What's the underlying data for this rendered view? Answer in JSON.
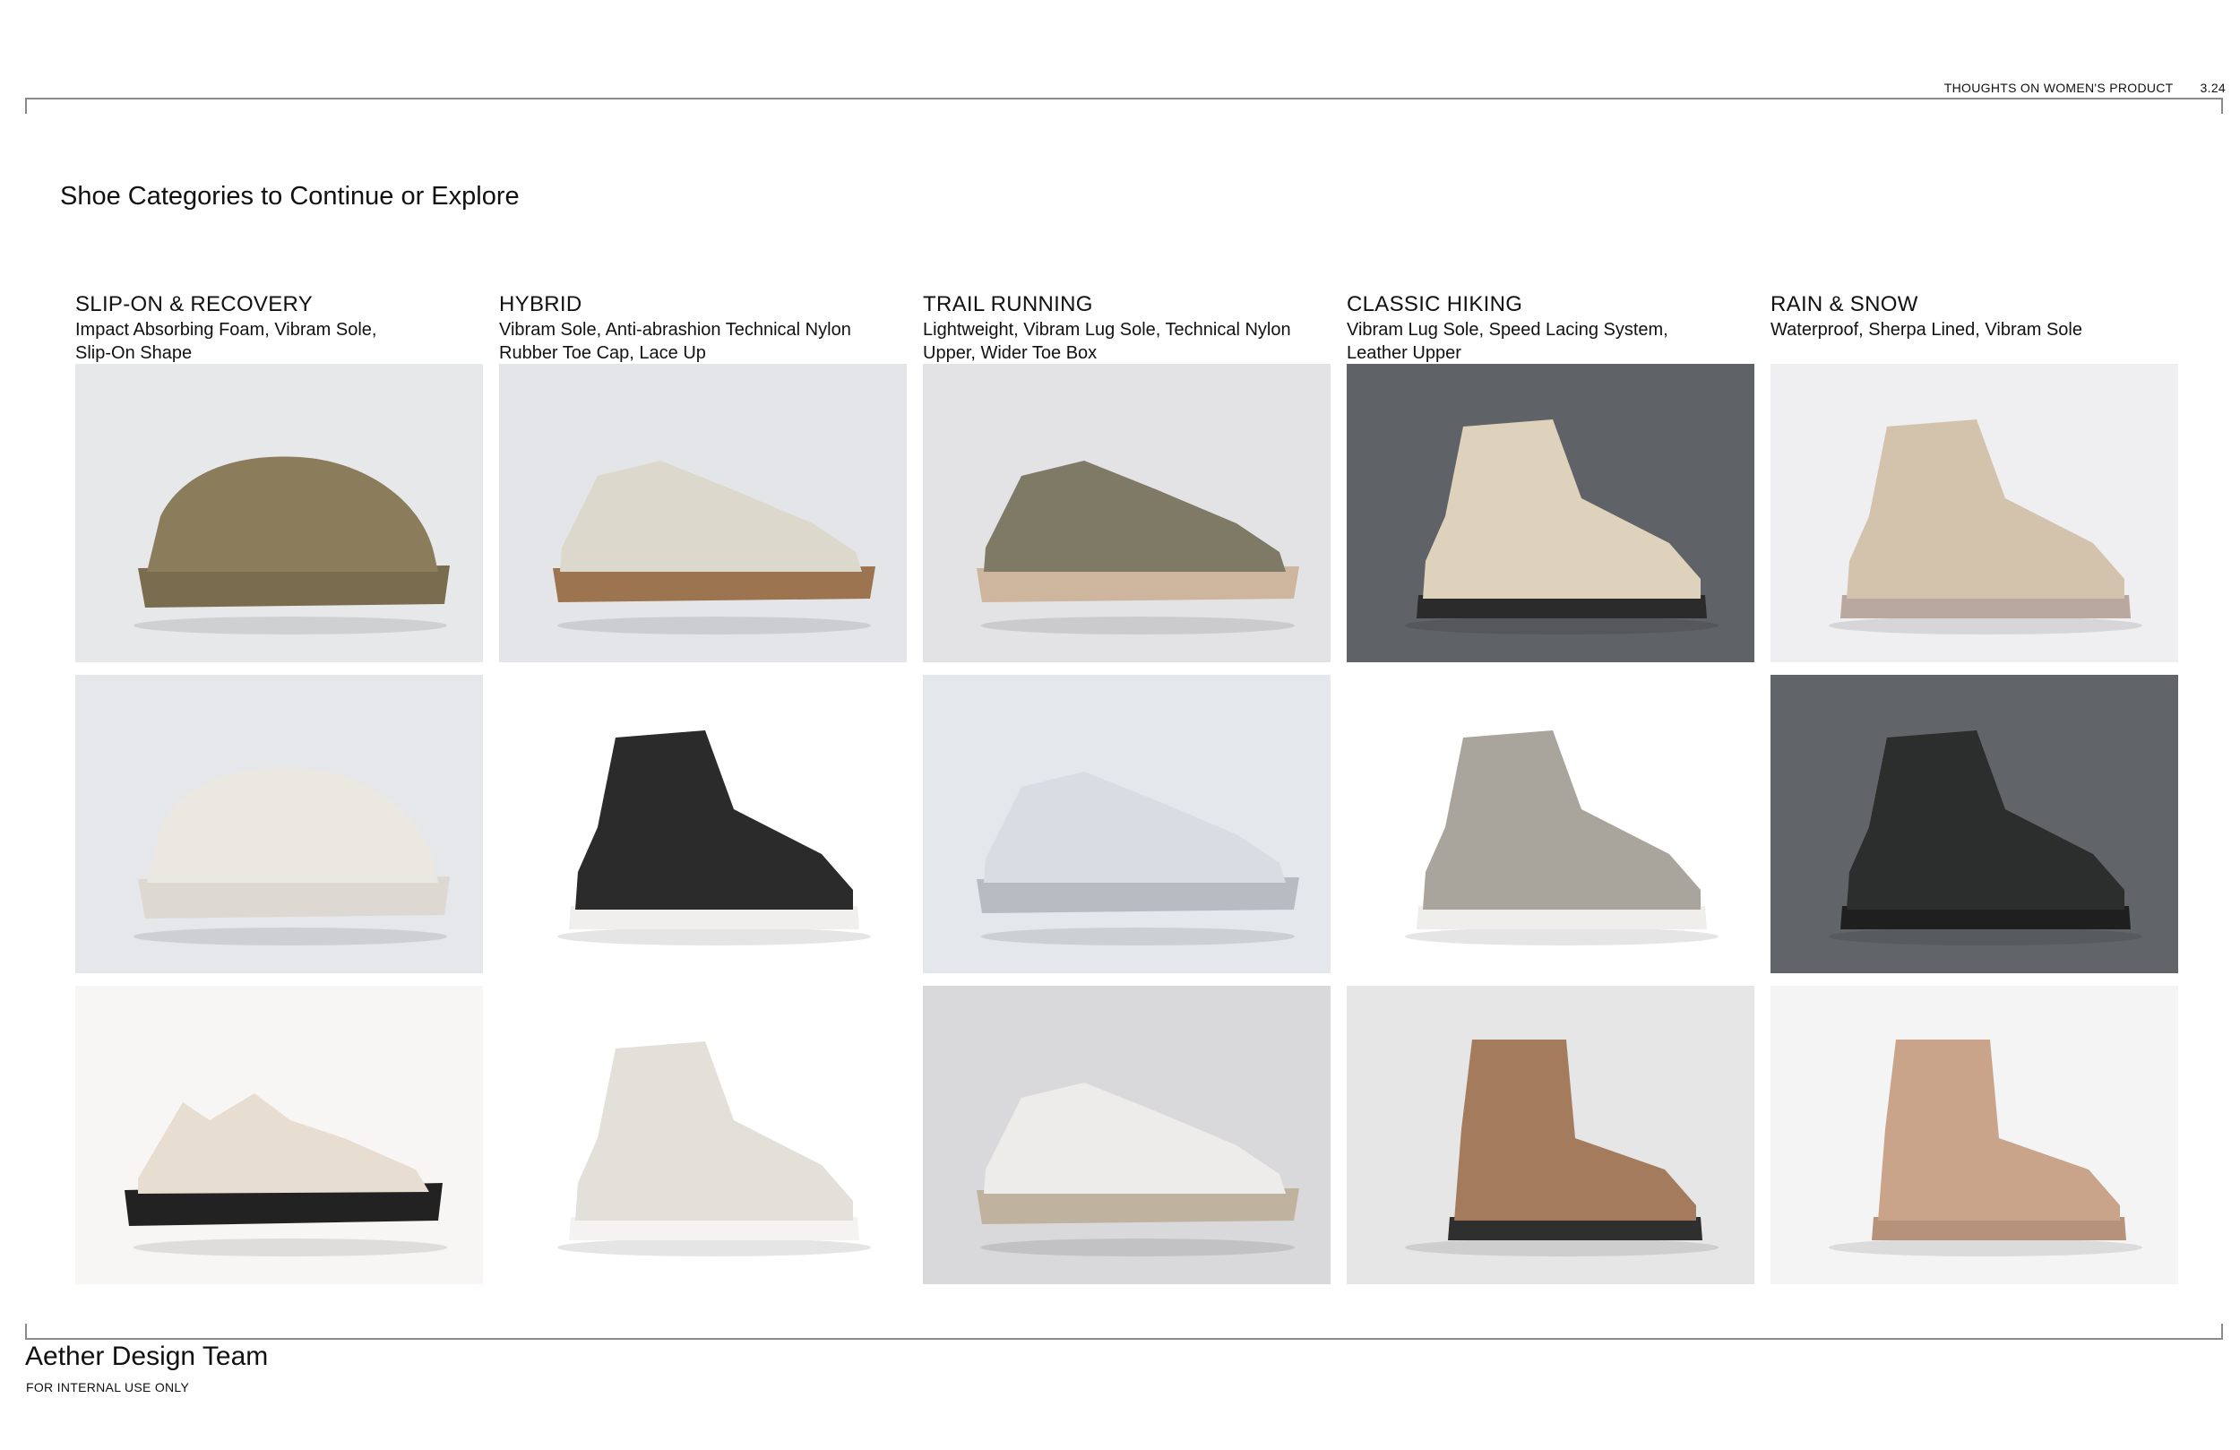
{
  "header": {
    "doc_title": "THOUGHTS ON WOMEN'S PRODUCT",
    "page_number": "3.24"
  },
  "page_title": "Shoe Categories to Continue or Explore",
  "categories": [
    {
      "name": "SLIP-ON & RECOVERY",
      "desc_line1": "Impact Absorbing Foam, Vibram Sole,",
      "desc_line2": "Slip-On Shape",
      "images": [
        {
          "name": "olive-strap-clog-image",
          "bg": "#e7e8ea",
          "upper": "#8b7c5b",
          "sole": "#7a6c4f",
          "style": "clog"
        },
        {
          "name": "white-mule-clog-image",
          "bg": "#e6e7ea",
          "upper": "#ebe8e2",
          "sole": "#ddd9d2",
          "style": "clog"
        },
        {
          "name": "chloe-strap-sandal-image",
          "bg": "#f8f6f4",
          "upper": "#e7ddd0",
          "sole": "#222222",
          "style": "sandal"
        }
      ]
    },
    {
      "name": "HYBRID",
      "desc_line1": "Vibram Sole, Anti-abrashion Technical Nylon",
      "desc_line2": "Rubber Toe Cap, Lace Up",
      "images": [
        {
          "name": "cream-hybrid-shoe-image",
          "bg": "#e4e5e8",
          "upper": "#ddd8cc",
          "sole": "#9c7550",
          "style": "low"
        },
        {
          "name": "black-hiking-boot-image",
          "bg": "#ffffff",
          "upper": "#2b2b2b",
          "sole": "#f0efed",
          "style": "boot"
        },
        {
          "name": "white-hiking-sneaker-image",
          "bg": "#ffffff",
          "upper": "#e3e0da",
          "sole": "#f4f3f1",
          "style": "boot"
        }
      ]
    },
    {
      "name": "TRAIL RUNNING",
      "desc_line1": "Lightweight, Vibram Lug Sole, Technical Nylon",
      "desc_line2": "Upper, Wider Toe Box",
      "images": [
        {
          "name": "olive-trail-runner-image",
          "bg": "#e3e3e6",
          "upper": "#7e7a66",
          "sole": "#cdb59e",
          "style": "low"
        },
        {
          "name": "silver-trail-runner-image",
          "bg": "#e4e7ec",
          "upper": "#d9dde3",
          "sole": "#b8bcc2",
          "style": "low"
        },
        {
          "name": "cream-trail-runner-image",
          "bg": "#d9d9dc",
          "upper": "#eeecea",
          "sole": "#bfb29e",
          "style": "low"
        }
      ]
    },
    {
      "name": "CLASSIC HIKING",
      "desc_line1": "Vibram Lug Sole, Speed Lacing System,",
      "desc_line2": "Leather Upper",
      "images": [
        {
          "name": "beige-hiking-boots-image",
          "bg": "#5f6266",
          "upper": "#dfd2bd",
          "sole": "#2b2b2b",
          "style": "boot"
        },
        {
          "name": "grey-suede-hiking-boot-image",
          "bg": "#ffffff",
          "upper": "#a9a49c",
          "sole": "#f0eeea",
          "style": "boot"
        },
        {
          "name": "tan-chelsea-boot-image",
          "bg": "#e6e6e6",
          "upper": "#a47c5d",
          "sole": "#2f2f2f",
          "style": "chelsea"
        }
      ]
    },
    {
      "name": "RAIN & SNOW",
      "desc_line1": "Waterproof, Sherpa Lined, Vibram Sole",
      "desc_line2": "",
      "images": [
        {
          "name": "beige-snow-boot-image",
          "bg": "#efeff1",
          "upper": "#d3c3ad",
          "sole": "#b9a8a0",
          "style": "boot"
        },
        {
          "name": "black-rain-boots-image",
          "bg": "#616569",
          "upper": "#2b2e2d",
          "sole": "#1f1f1f",
          "style": "boot"
        },
        {
          "name": "shearling-rain-boots-image",
          "bg": "#f4f4f4",
          "upper": "#c9a48a",
          "sole": "#b6927a",
          "style": "chelsea"
        }
      ]
    }
  ],
  "footer": {
    "brand": "Aether Design Team",
    "note": "FOR INTERNAL USE ONLY"
  }
}
